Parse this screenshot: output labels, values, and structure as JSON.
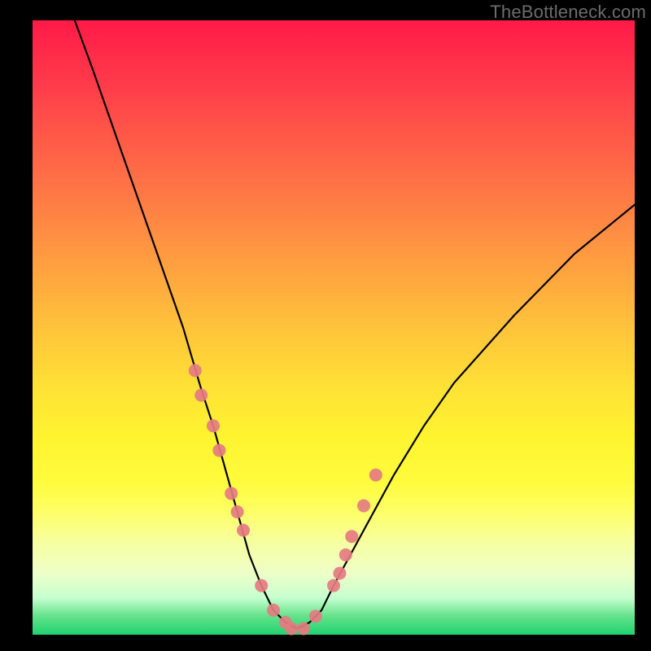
{
  "watermark": "TheBottleneck.com",
  "chart_data": {
    "type": "line",
    "title": "",
    "xlabel": "",
    "ylabel": "",
    "xlim": [
      0,
      100
    ],
    "ylim": [
      0,
      100
    ],
    "grid": false,
    "series": [
      {
        "name": "bottleneck-curve",
        "color": "#000000",
        "x": [
          7,
          10,
          15,
          20,
          25,
          28,
          30,
          32,
          34,
          36,
          38,
          40,
          42,
          44,
          46,
          48,
          50,
          55,
          60,
          65,
          70,
          80,
          90,
          100
        ],
        "y": [
          100,
          92,
          78,
          64,
          50,
          40,
          34,
          27,
          20,
          13,
          8,
          4,
          2,
          1,
          2,
          4,
          8,
          17,
          26,
          34,
          41,
          52,
          62,
          70
        ]
      }
    ],
    "markers": {
      "name": "highlight-points",
      "color": "#e57b82",
      "radius_px": 8,
      "x": [
        27,
        28,
        30,
        31,
        33,
        34,
        35,
        38,
        40,
        42,
        43,
        45,
        47,
        50,
        51,
        52,
        53,
        55,
        57
      ],
      "y": [
        43,
        39,
        34,
        30,
        23,
        20,
        17,
        8,
        4,
        2,
        1,
        1,
        3,
        8,
        10,
        13,
        16,
        21,
        26
      ]
    },
    "background_gradient": {
      "direction": "top-to-bottom",
      "stops": [
        {
          "pct": 0,
          "color": "#ff1a47"
        },
        {
          "pct": 50,
          "color": "#ffc33b"
        },
        {
          "pct": 80,
          "color": "#fdff66"
        },
        {
          "pct": 100,
          "color": "#1fd36f"
        }
      ]
    }
  }
}
